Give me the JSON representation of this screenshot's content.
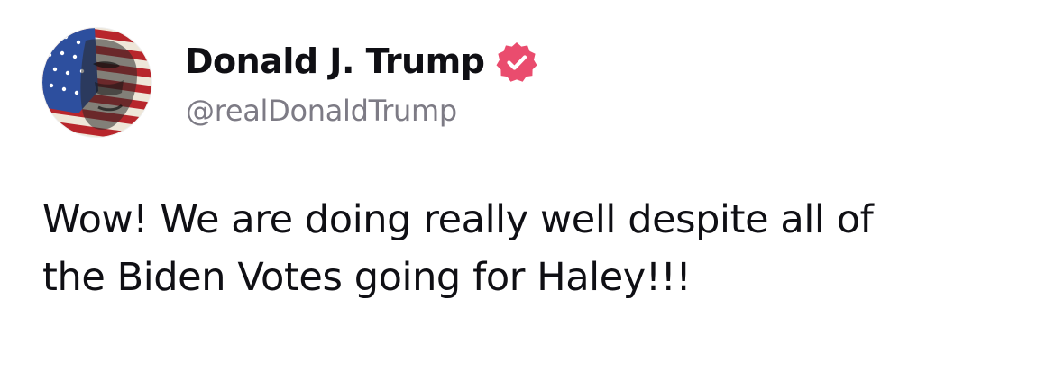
{
  "author": {
    "display_name": "Donald J. Trump",
    "handle": "@realDonaldTrump",
    "verified": true,
    "verified_badge_icon": "verified-badge-icon",
    "avatar_icon": "flag-portrait-avatar"
  },
  "post": {
    "line1": "Wow! We are doing really well despite all of",
    "line2": "the Biden Votes going for Haley!!!"
  },
  "colors": {
    "text": "#0f0f14",
    "handle": "#7d7b85",
    "badge": "#ea4c6e"
  }
}
